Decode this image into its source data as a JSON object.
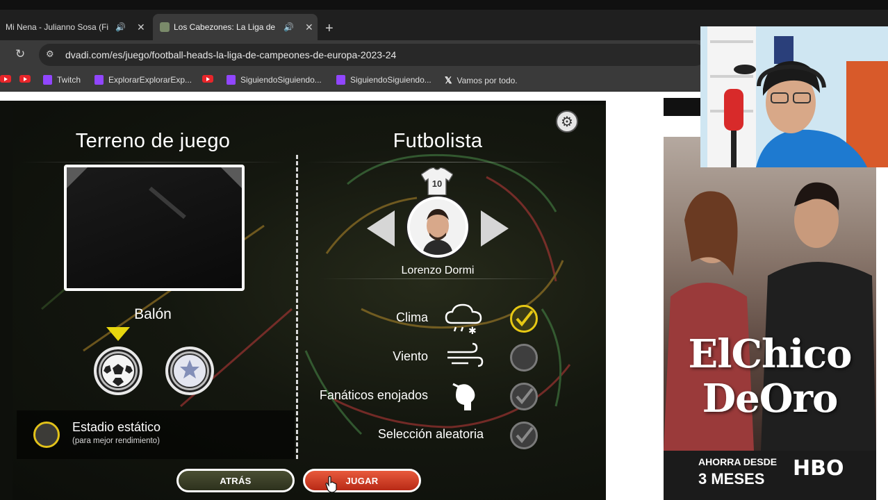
{
  "browser": {
    "tabs": [
      {
        "title": "Mi Nena - Julianno Sosa (Fi",
        "active": false
      },
      {
        "title": "Los Cabezones: La Liga de C",
        "active": true
      }
    ],
    "url": "dvadi.com/es/juego/football-heads-la-liga-de-campeones-de-europa-2023-24",
    "bookmarks": [
      {
        "label": "",
        "icon": "youtube-icon"
      },
      {
        "label": "Twitch",
        "icon": "twitch-icon"
      },
      {
        "label": "ExplorarExplorarExp...",
        "icon": "twitch-icon"
      },
      {
        "label": "",
        "icon": "youtube-icon"
      },
      {
        "label": "SiguiendoSiguiendo...",
        "icon": "twitch-icon"
      },
      {
        "label": "SiguiendoSiguiendo...",
        "icon": "twitch-icon"
      },
      {
        "label": "Vamos por todo.",
        "icon": "x-icon"
      }
    ]
  },
  "game": {
    "left_header": "Terreno de juego",
    "right_header": "Futbolista",
    "ball_label": "Balón",
    "stadium_option": {
      "label": "Estadio estático",
      "sublabel": "(para mejor rendimiento)",
      "selected": false
    },
    "shirt_number": "10",
    "player_name": "Lorenzo Dormi",
    "options": [
      {
        "label": "Clima",
        "icon": "snow-rain-cloud-icon",
        "checked": true
      },
      {
        "label": "Viento",
        "icon": "wind-icon",
        "checked": false
      },
      {
        "label": "Fanáticos enojados",
        "icon": "angry-fan-icon",
        "checked": false
      },
      {
        "label": "Selección aleatoria",
        "icon": "",
        "checked": false
      }
    ],
    "buttons": {
      "back": "ATRÁS",
      "play": "JUGAR"
    }
  },
  "ad": {
    "title_line1": "ElChico",
    "title_line2": "DeOro",
    "promo_line1": "AHORRA DESDE",
    "promo_line2": "3 MESES",
    "brand": "HBO"
  },
  "colors": {
    "accent_yellow": "#e6c814",
    "play_red": "#d8402a",
    "back_olive": "#3b3f27"
  }
}
